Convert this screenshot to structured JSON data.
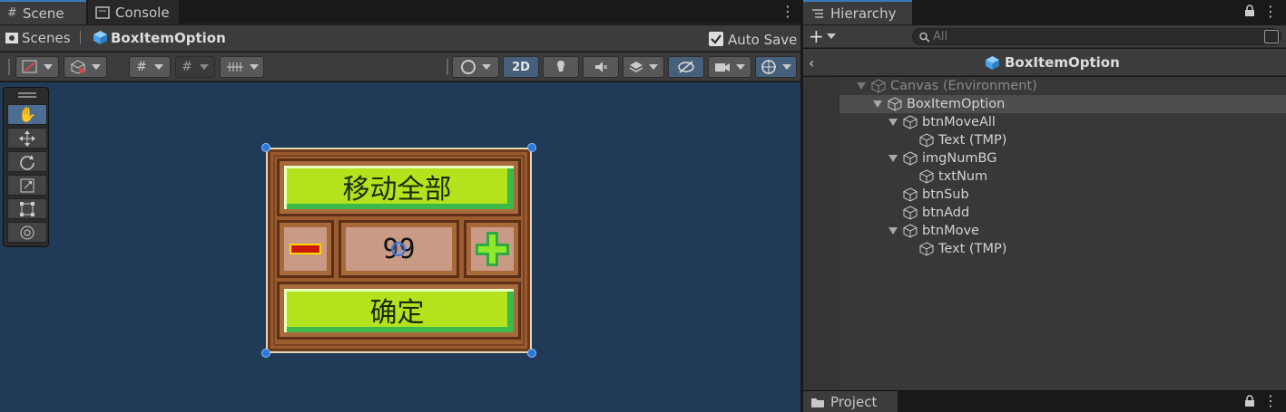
{
  "scene_panel": {
    "tabs": [
      {
        "label": "Scene"
      },
      {
        "label": "Console"
      }
    ],
    "breadcrumb": {
      "root": "Scenes",
      "current": "BoxItemOption"
    },
    "auto_save": {
      "label": "Auto Save",
      "checked": true
    },
    "toolbar": {
      "mode_2d_label": "2D"
    }
  },
  "game_view": {
    "move_all_label": "移动全部",
    "count_value": "99",
    "confirm_label": "确定",
    "colors": {
      "wood": "#8a4f2a",
      "button_green": "#b4e21c",
      "count_bg": "#c99a86",
      "minus_red": "#cc1a0a",
      "plus_green": "#7fdc22"
    }
  },
  "hierarchy_panel": {
    "tab_label": "Hierarchy",
    "search_placeholder": "All",
    "header_title": "BoxItemOption",
    "rows": [
      {
        "label": "Canvas (Environment)"
      },
      {
        "label": "BoxItemOption"
      },
      {
        "label": "btnMoveAll"
      },
      {
        "label": "Text (TMP)"
      },
      {
        "label": "imgNumBG"
      },
      {
        "label": "txtNum"
      },
      {
        "label": "btnSub"
      },
      {
        "label": "btnAdd"
      },
      {
        "label": "btnMove"
      },
      {
        "label": "Text (TMP)"
      }
    ]
  },
  "project_panel": {
    "tab_label": "Project"
  },
  "colors": {
    "accent": "#3a79bb",
    "viewport_bg": "#213a58",
    "panel_bg": "#383838",
    "selection": "#4d4d4d"
  }
}
